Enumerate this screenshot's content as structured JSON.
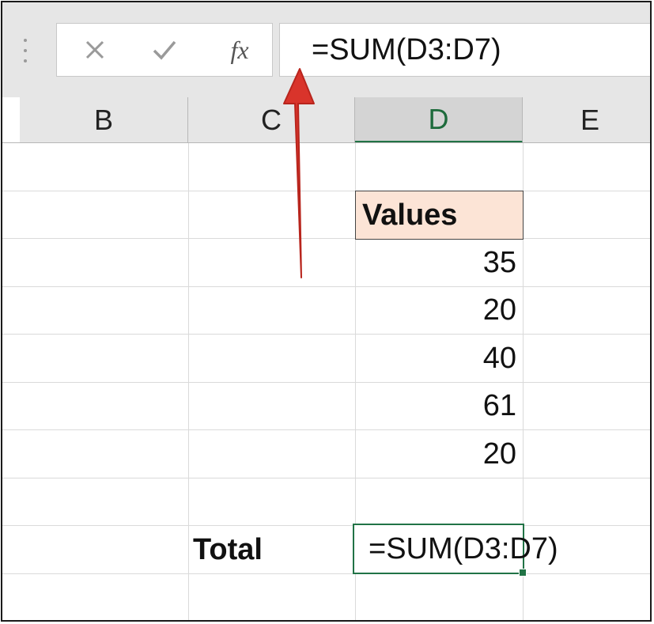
{
  "formula_bar": {
    "cancel_icon": "close-icon",
    "enter_icon": "checkmark-icon",
    "function_label": "fx",
    "formula": "=SUM(D3:D7)"
  },
  "columns": [
    "B",
    "C",
    "D",
    "E"
  ],
  "selected_column": "D",
  "cells": {
    "header": "Values",
    "values": [
      "35",
      "20",
      "40",
      "61",
      "20"
    ],
    "total_label": "Total",
    "total_formula": "=SUM(D3:D7)"
  },
  "colors": {
    "accent": "#217346",
    "header_fill": "#fce4d6",
    "arrow": "#d9342b"
  }
}
